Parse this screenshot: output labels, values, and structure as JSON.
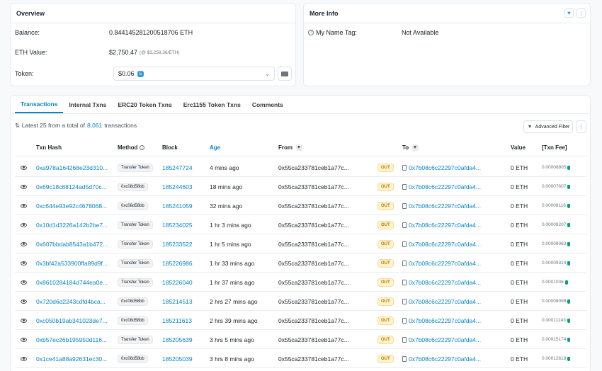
{
  "overview": {
    "title": "Overview",
    "balance_label": "Balance:",
    "balance_value": "0.844145281200518706 ETH",
    "eth_value_label": "ETH Value:",
    "eth_value": "$2,750.47",
    "eth_price": "(@ $3,258.36/ETH)",
    "token_label": "Token:",
    "token_value": "$0.06",
    "token_count": "5"
  },
  "more_info": {
    "title": "More Info",
    "name_tag_label": "My Name Tag:",
    "name_tag_value": "Not Available"
  },
  "tabs": [
    {
      "label": "Transactions",
      "active": true
    },
    {
      "label": "Internal Txns"
    },
    {
      "label": "ERC20 Token Txns"
    },
    {
      "label": "Erc1155 Token Txns"
    },
    {
      "label": "Comments"
    }
  ],
  "summary": {
    "prefix": "Latest 25 from a total of",
    "count": "8,061",
    "suffix": "transactions"
  },
  "advanced_filter_label": "Advanced Filter",
  "columns": {
    "hash": "Txn Hash",
    "method": "Method",
    "block": "Block",
    "age": "Age",
    "from": "From",
    "to": "To",
    "value": "Value",
    "fee": "[Txn Fee]"
  },
  "rows": [
    {
      "hash": "0xa978a164268e23d310...",
      "method": "Transfer Token",
      "block": "185247724",
      "age": "4 mins ago",
      "from": "0x55ca233781ceb1a77c...",
      "dir": "OUT",
      "to": "0x7b08c6c22297c0afda4...",
      "value": "0 ETH",
      "fee": "0.00008805"
    },
    {
      "hash": "0x69c18c88124ad5d70c...",
      "method": "0xc08d58bb",
      "block": "185244603",
      "age": "18 mins ago",
      "from": "0x55ca233781ceb1a77c...",
      "dir": "OUT",
      "to": "0x7b08c6c22297c0afda4...",
      "value": "0 ETH",
      "fee": "0.00007607"
    },
    {
      "hash": "0xc644e93e92c4678068...",
      "method": "0xc08d58bb",
      "block": "185241059",
      "age": "32 mins ago",
      "from": "0x55ca233781ceb1a77c...",
      "dir": "OUT",
      "to": "0x7b08c6c22297c0afda4...",
      "value": "0 ETH",
      "fee": "0.00008116"
    },
    {
      "hash": "0x10d1d3226a142b2be7...",
      "method": "Transfer Token",
      "block": "185234025",
      "age": "1 hr 3 mins ago",
      "from": "0x55ca233781ceb1a77c...",
      "dir": "OUT",
      "to": "0x7b08c6c22297c0afda4...",
      "value": "0 ETH",
      "fee": "0.00009207"
    },
    {
      "hash": "0x607bbdab8543a1b472...",
      "method": "Transfer Token",
      "block": "185233522",
      "age": "1 hr 5 mins ago",
      "from": "0x55ca233781ceb1a77c...",
      "dir": "OUT",
      "to": "0x7b08c6c22297c0afda4...",
      "value": "0 ETH",
      "fee": "0.00009083"
    },
    {
      "hash": "0x3bf42a533900ffa89d9f...",
      "method": "Transfer Token",
      "block": "185226986",
      "age": "1 hr 33 mins ago",
      "from": "0x55ca233781ceb1a77c...",
      "dir": "OUT",
      "to": "0x7b08c6c22297c0afda4...",
      "value": "0 ETH",
      "fee": "0.00009314"
    },
    {
      "hash": "0x8610284184d744ea0e...",
      "method": "Transfer Token",
      "block": "185226040",
      "age": "1 hr 37 mins ago",
      "from": "0x55ca233781ceb1a77c...",
      "dir": "OUT",
      "to": "0x7b08c6c22297c0afda4...",
      "value": "0 ETH",
      "fee": "0.0001036"
    },
    {
      "hash": "0x720d6d2243cdfd4bca...",
      "method": "0xc08d58bb",
      "block": "185214513",
      "age": "2 hrs 27 mins ago",
      "from": "0x55ca233781ceb1a77c...",
      "dir": "OUT",
      "to": "0x7b08c6c22297c0afda4...",
      "value": "0 ETH",
      "fee": "0.00008098"
    },
    {
      "hash": "0xc050b19ab341023de7...",
      "method": "0xc08d58bb",
      "block": "185211613",
      "age": "2 hrs 39 mins ago",
      "from": "0x55ca233781ceb1a77c...",
      "dir": "OUT",
      "to": "0x7b08c6c22297c0afda4...",
      "value": "0 ETH",
      "fee": "0.00011243"
    },
    {
      "hash": "0xb57ec26b195950d116...",
      "method": "Transfer Token",
      "block": "185205639",
      "age": "3 hrs 5 mins ago",
      "from": "0x55ca233781ceb1a77c...",
      "dir": "OUT",
      "to": "0x7b08c6c22297c0afda4...",
      "value": "0 ETH",
      "fee": "0.00015174"
    },
    {
      "hash": "0x1ce41a88a92631ec30...",
      "method": "0xc08d58bb",
      "block": "185205039",
      "age": "3 hrs 8 mins ago",
      "from": "0x55ca233781ceb1a77c...",
      "dir": "OUT",
      "to": "0x7b08c6c22297c0afda4...",
      "value": "0 ETH",
      "fee": "0.00012618"
    }
  ]
}
